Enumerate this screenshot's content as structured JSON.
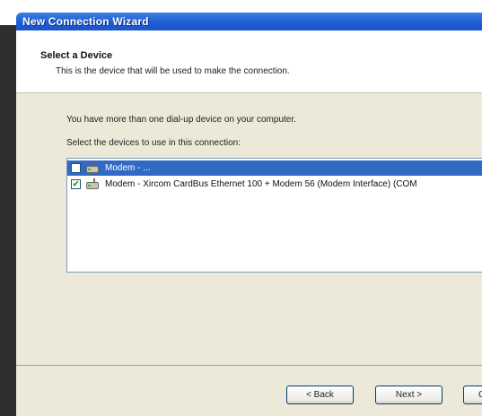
{
  "window": {
    "title": "New Connection Wizard"
  },
  "header": {
    "title": "Select a Device",
    "subtitle": "This is the device that will be used to make the connection."
  },
  "body": {
    "intro_line1": "You have more than one dial-up device on your computer.",
    "intro_line2": "Select the devices to use in this connection:"
  },
  "devices": [
    {
      "label": "Modem - ...",
      "checked": false,
      "selected": true,
      "icon": "modem-icon"
    },
    {
      "label": "Modem - Xircom CardBus Ethernet 100 + Modem 56 (Modem Interface) (COM",
      "checked": true,
      "selected": false,
      "icon": "modem-icon"
    }
  ],
  "buttons": {
    "back": "< Back",
    "next": "Next >",
    "cancel": "C"
  },
  "colors": {
    "titlebar": "#1f5dd3",
    "selection": "#316ac5",
    "dialog_bg": "#ece9d8"
  }
}
